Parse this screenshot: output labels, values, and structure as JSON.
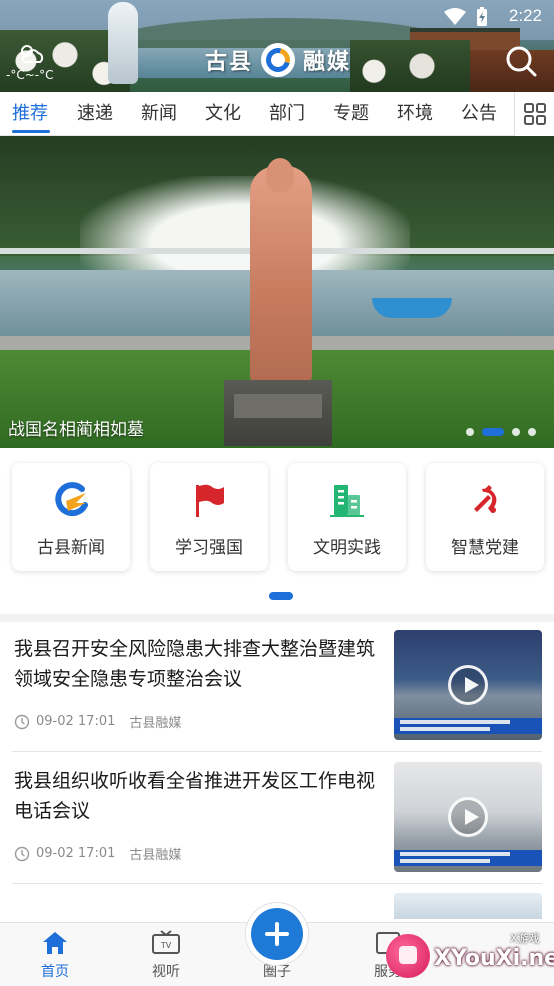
{
  "status_bar": {
    "time": "2:22"
  },
  "header": {
    "title_left": "古县",
    "title_right": "融媒",
    "weather_temp": "-°C~-°C"
  },
  "tabs": {
    "items": [
      "推荐",
      "速递",
      "新闻",
      "文化",
      "部门",
      "专题",
      "环境",
      "公告"
    ],
    "active_index": 0
  },
  "banner": {
    "caption": "战国名相蔺相如墓",
    "page_count": 4,
    "active_page": 2
  },
  "shortcuts": [
    {
      "label": "古县新闻",
      "icon": "guxian-logo-icon"
    },
    {
      "label": "学习强国",
      "icon": "red-flag-icon"
    },
    {
      "label": "文明实践",
      "icon": "green-building-icon"
    },
    {
      "label": "智慧党建",
      "icon": "party-emblem-icon"
    }
  ],
  "news": [
    {
      "title": "我县召开安全风险隐患大排查大整治暨建筑领域安全隐患专项整治会议",
      "date": "09-02 17:01",
      "source": "古县融媒"
    },
    {
      "title": "我县组织收听收看全省推进开发区工作电视电话会议",
      "date": "09-02 17:01",
      "source": "古县融媒"
    }
  ],
  "bottom_nav": {
    "items": [
      "首页",
      "视听",
      "圈子",
      "服务"
    ],
    "active_index": 0
  },
  "watermark": {
    "text": "XYouXi.net",
    "small": "X游戏"
  },
  "colors": {
    "accent": "#1e6fd9",
    "party_red": "#d6262b",
    "green": "#22b573"
  }
}
